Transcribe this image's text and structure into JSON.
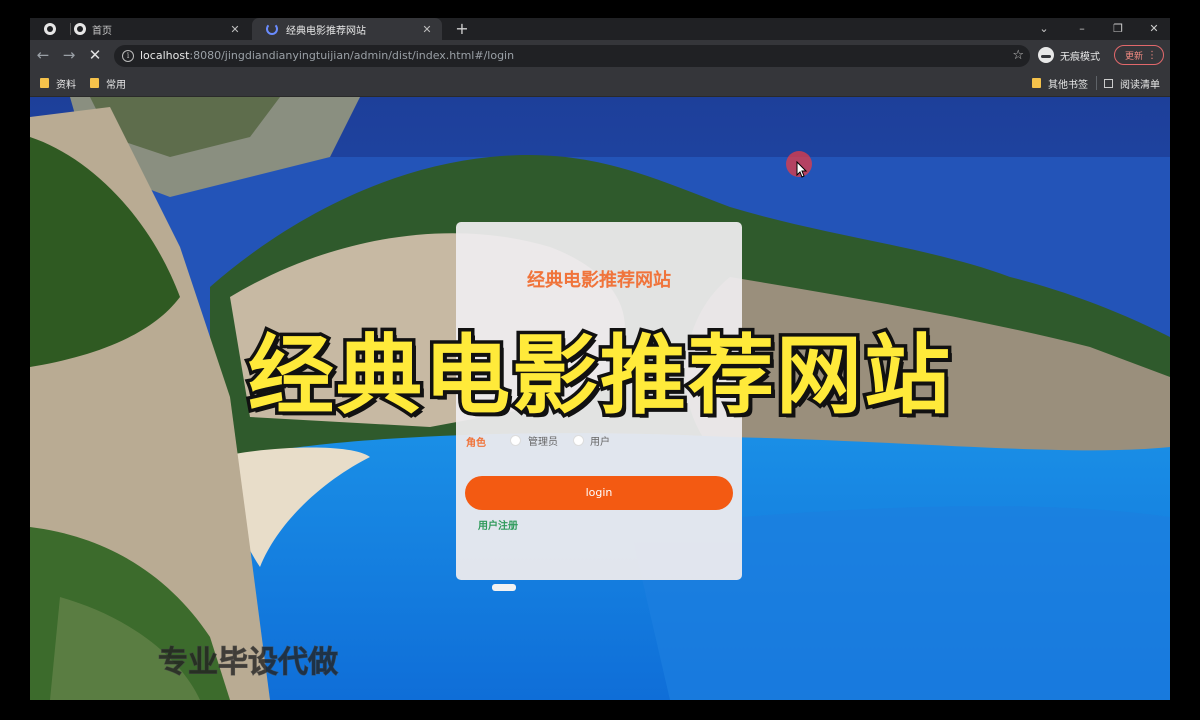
{
  "browser": {
    "tabs": [
      {
        "title": "",
        "favicon": "globe-icon"
      },
      {
        "title": "首页",
        "favicon": "globe-icon"
      },
      {
        "title": "经典电影推荐网站",
        "favicon": "loading-spinner-icon",
        "active": true
      }
    ],
    "new_tab_glyph": "+",
    "window_controls": {
      "dropdown": "⌄",
      "minimize": "–",
      "restore": "❐",
      "close": "✕"
    },
    "nav": {
      "back": "←",
      "forward": "→",
      "stop": "✕"
    },
    "url": {
      "host": "localhost",
      "rest": ":8080/jingdiandianyingtuijian/admin/dist/index.html#/login"
    },
    "incognito_label": "无痕模式",
    "update_label": "更新",
    "bookmarks": [
      {
        "label": "资料"
      },
      {
        "label": "常用"
      }
    ],
    "bookmarks_right": [
      {
        "label": "其他书签"
      },
      {
        "label": "阅读清单"
      }
    ]
  },
  "login": {
    "title": "经典电影推荐网站",
    "role_label": "角色",
    "roles": [
      "管理员",
      "用户"
    ],
    "button_label": "login",
    "register_label": "用户注册"
  },
  "overlay": {
    "title": "经典电影推荐网站",
    "watermark": "专业毕设代做"
  },
  "colors": {
    "accent": "#f35a12",
    "title": "#f0743b",
    "register": "#2e9a5a",
    "overlay_text": "#ffea3a"
  }
}
